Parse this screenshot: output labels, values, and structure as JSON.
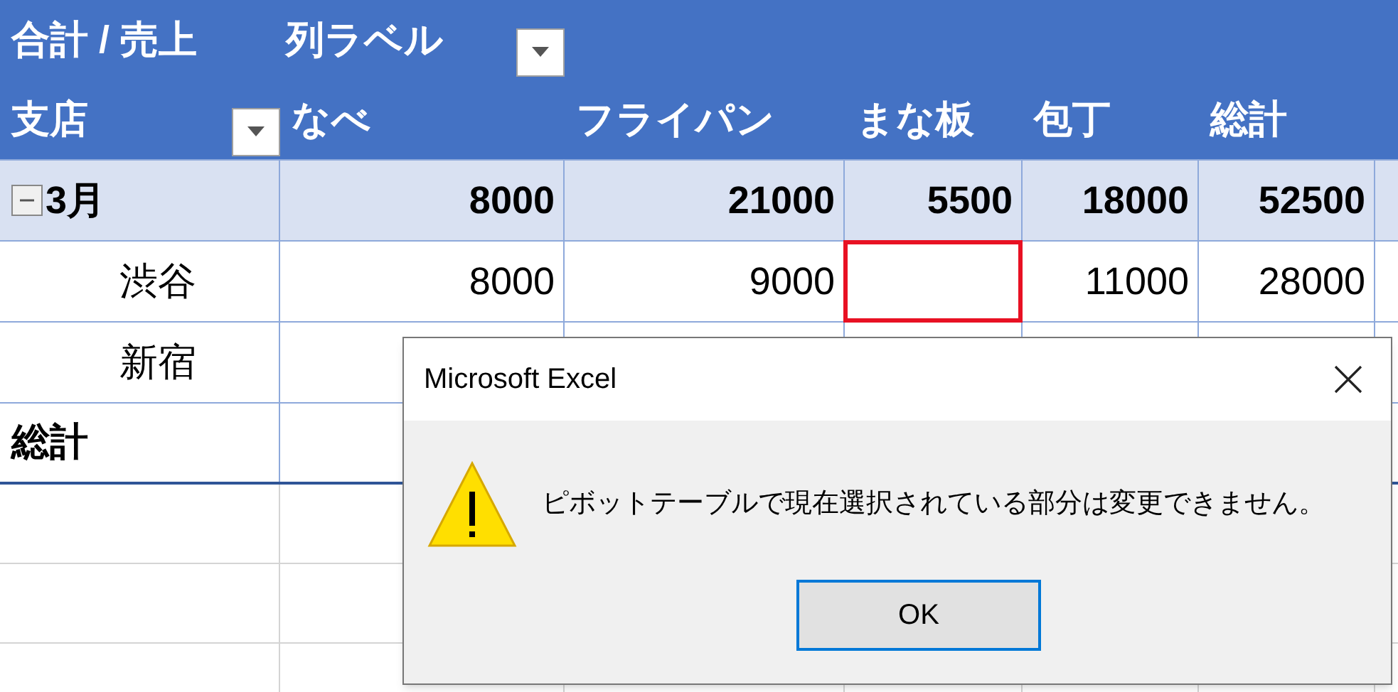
{
  "pivot": {
    "title": "合計 / 売上",
    "column_label": "列ラベル",
    "row_label": "支店",
    "columns": [
      "なべ",
      "フライパン",
      "まな板",
      "包丁",
      "総計"
    ],
    "rows": [
      {
        "kind": "group",
        "label": "3月",
        "expanded": true,
        "cells": [
          {
            "text": "8000",
            "selected": false
          },
          {
            "text": "21000",
            "selected": false
          },
          {
            "text": "5500",
            "selected": false
          },
          {
            "text": "18000",
            "selected": false
          },
          {
            "text": "52500",
            "selected": false
          }
        ]
      },
      {
        "kind": "item",
        "label": "渋谷",
        "cells": [
          {
            "text": "8000",
            "selected": false
          },
          {
            "text": "9000",
            "selected": false
          },
          {
            "selected": true
          },
          {
            "text": "11000",
            "selected": false
          },
          {
            "text": "28000",
            "selected": false
          }
        ]
      },
      {
        "kind": "item",
        "label": "新宿"
      },
      {
        "kind": "total",
        "label": "総計"
      }
    ]
  },
  "dialog": {
    "title": "Microsoft Excel",
    "message": "ピボットテーブルで現在選択されている部分は変更できません。",
    "button": "OK"
  }
}
